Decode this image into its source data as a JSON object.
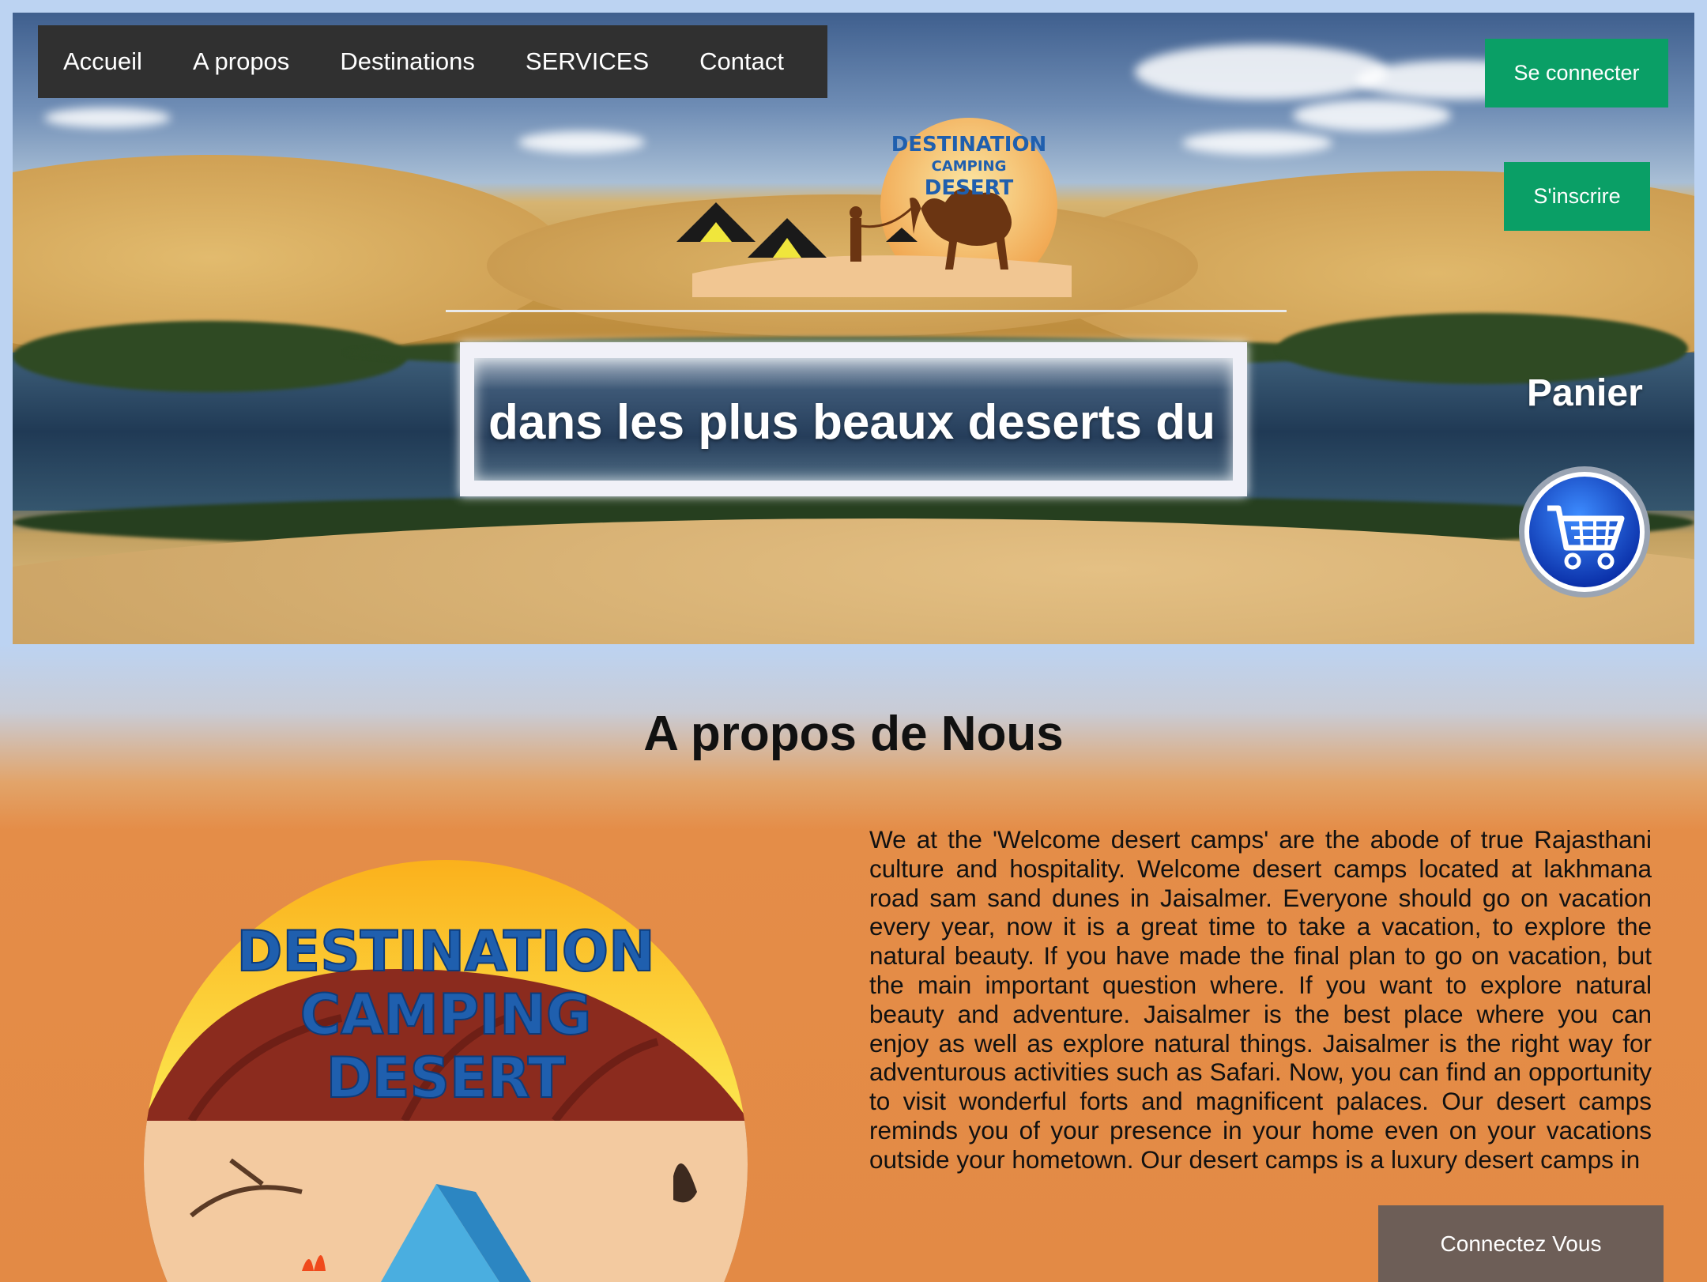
{
  "nav": {
    "items": [
      {
        "label": "Accueil"
      },
      {
        "label": "A propos"
      },
      {
        "label": "Destinations"
      },
      {
        "label": "SERVICES"
      },
      {
        "label": "Contact"
      }
    ]
  },
  "auth": {
    "login_label": "Se connecter",
    "signup_label": "S'inscrire"
  },
  "hero": {
    "marquee_text": "dans les plus beaux deserts du",
    "logo_text": {
      "line1": "DESTINATION",
      "line2": "CAMPING",
      "line3": "DESERT"
    }
  },
  "cart": {
    "label": "Panier",
    "icon": "shopping-cart-icon"
  },
  "about": {
    "title": "A propos de Nous",
    "logo_text": {
      "line1": "DESTINATION",
      "line2": "CAMPING",
      "line3": "DESERT"
    },
    "body": "We at the 'Welcome desert camps' are the abode of true Rajasthani culture and hospitality. Welcome desert camps located at lakhmana road sam sand dunes in Jaisalmer. Everyone should go on vacation every year, now it is a great time to take a vacation, to explore the natural beauty. If you have made the final plan to go on vacation, but the main important question where. If you want to explore natural beauty and adventure. Jaisalmer is the best place where you can enjoy as well as explore natural things. Jaisalmer is the right way for adventurous activities such as Safari. Now, you can find an opportunity to visit wonderful forts and magnificent palaces. Our desert camps reminds you of your presence in your home even on your vacations outside your hometown. Our desert camps is a luxury desert camps in",
    "cta_label": "Connectez Vous"
  },
  "colors": {
    "nav_bg": "#303030",
    "green_button": "#0a9f66",
    "cta_button": "#6d5e57",
    "logo_blue": "#1f5fae"
  }
}
